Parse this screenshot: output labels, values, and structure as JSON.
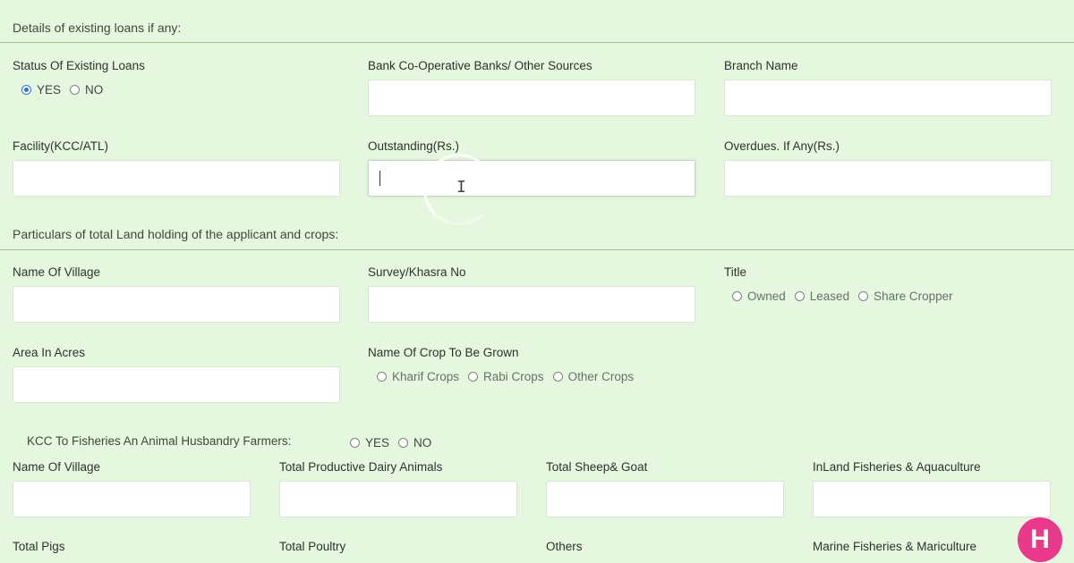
{
  "section_existing_loans": {
    "title": "Details of existing loans if any:",
    "status_label": "Status Of Existing Loans",
    "status_options": [
      "YES",
      "NO"
    ],
    "status_selected": "YES",
    "bank_label": "Bank Co-Operative Banks/ Other Sources",
    "branch_label": "Branch Name",
    "facility_label": "Facility(KCC/ATL)",
    "outstanding_label": "Outstanding(Rs.)",
    "overdues_label": "Overdues. If Any(Rs.)"
  },
  "section_land": {
    "title": "Particulars of total Land holding of the applicant and crops:",
    "village_label": "Name Of Village",
    "survey_label": "Survey/Khasra No",
    "title_label": "Title",
    "title_options": [
      "Owned",
      "Leased",
      "Share Cropper"
    ],
    "area_label": "Area In Acres",
    "crop_label": "Name Of Crop To Be Grown",
    "crop_options": [
      "Kharif Crops",
      "Rabi Crops",
      "Other Crops"
    ]
  },
  "section_fisheries": {
    "question": "KCC To Fisheries An Animal Husbandry Farmers:",
    "options": [
      "YES",
      "NO"
    ],
    "village_label": "Name Of Village",
    "dairy_label": "Total Productive Dairy Animals",
    "sheep_label": "Total Sheep& Goat",
    "inland_label": "InLand Fisheries & Aquaculture",
    "pigs_label": "Total Pigs",
    "poultry_label": "Total Poultry",
    "others_label": "Others",
    "marine_label": "Marine Fisheries & Mariculture"
  },
  "badge": {
    "letter": "H",
    "color": "#e8398a"
  },
  "accent_color": "#2b74d6"
}
